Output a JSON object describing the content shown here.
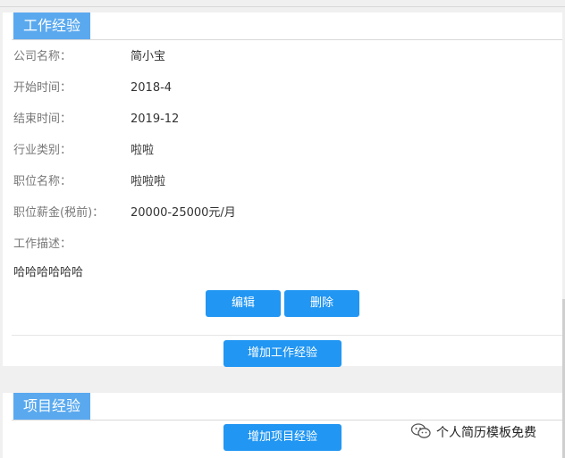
{
  "work_section": {
    "title": "工作经验",
    "fields": [
      {
        "label": "公司名称：",
        "value": "简小宝"
      },
      {
        "label": "开始时间：",
        "value": "2018-4"
      },
      {
        "label": "结束时间：",
        "value": "2019-12"
      },
      {
        "label": "行业类别：",
        "value": "啦啦"
      },
      {
        "label": "职位名称：",
        "value": "啦啦啦"
      },
      {
        "label": "职位薪金(税前)：",
        "value": "20000-25000元/月"
      },
      {
        "label": "工作描述：",
        "value": ""
      }
    ],
    "description": "哈哈哈哈哈哈",
    "edit_label": "编辑",
    "delete_label": "删除",
    "add_label": "增加工作经验"
  },
  "project_section": {
    "title": "项目经验",
    "add_label": "增加项目经验"
  },
  "watermark": {
    "text": "个人简历模板免费"
  },
  "colors": {
    "tab": "#5aa9ef",
    "button": "#2196f3"
  }
}
